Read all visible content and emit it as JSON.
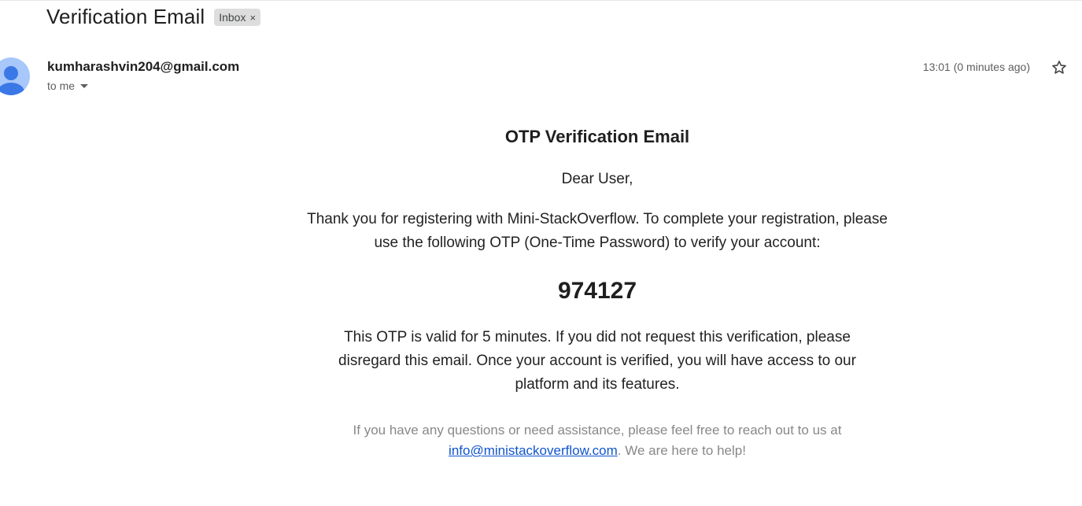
{
  "email": {
    "subject": "Verification Email",
    "label_chip": "Inbox",
    "label_remove": "×",
    "sender": "kumharashvin204@gmail.com",
    "recipient_line": "to me",
    "timestamp": "13:01 (0 minutes ago)",
    "avatar_icon": "person-icon",
    "star_icon": "star-outline-icon",
    "accent_color": "#a8c7fa"
  },
  "message": {
    "heading": "OTP Verification Email",
    "greeting": "Dear User,",
    "intro": "Thank you for registering with Mini-StackOverflow. To complete your registration, please use the following OTP (One-Time Password) to verify your account:",
    "otp_code": "974127",
    "validity": "This OTP is valid for 5 minutes. If you did not request this verification, please disregard this email. Once your account is verified, you will have access to our platform and its features.",
    "footer_before": "If you have any questions or need assistance, please feel free to reach out to us at",
    "footer_email": "info@ministackoverflow.com",
    "footer_after": ". We are here to help!",
    "link_color": "#1155cc"
  }
}
